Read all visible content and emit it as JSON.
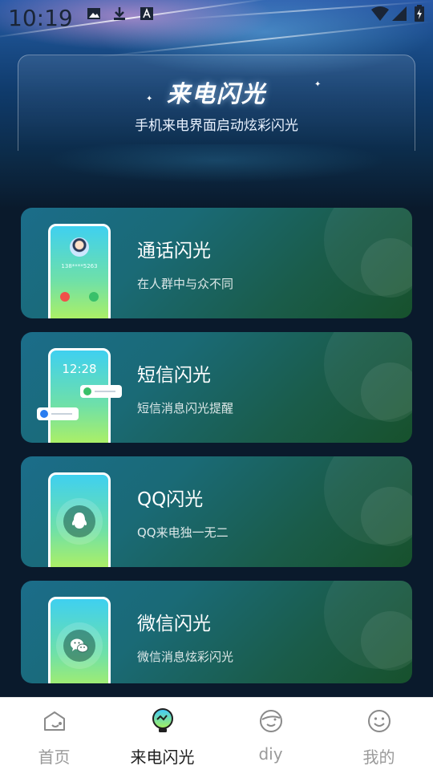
{
  "status_bar": {
    "time": "10:19",
    "icons": [
      "image-icon",
      "download-icon",
      "a-icon",
      "wifi-icon",
      "signal-icon",
      "battery-icon"
    ]
  },
  "header": {
    "title": "来电闪光",
    "subtitle": "手机来电界面启动炫彩闪光"
  },
  "cards": [
    {
      "title": "通话闪光",
      "desc": "在人群中与众不同",
      "phone_number": "138****5263"
    },
    {
      "title": "短信闪光",
      "desc": "短信消息闪光提醒",
      "phone_time": "12:28"
    },
    {
      "title": "QQ闪光",
      "desc": "QQ来电独一无二"
    },
    {
      "title": "微信闪光",
      "desc": "微信消息炫彩闪光"
    }
  ],
  "nav": {
    "items": [
      {
        "label": "首页",
        "icon": "home-icon",
        "active": false
      },
      {
        "label": "来电闪光",
        "icon": "lightbulb-icon",
        "active": true
      },
      {
        "label": "diy",
        "icon": "diy-face-icon",
        "active": false
      },
      {
        "label": "我的",
        "icon": "smiley-icon",
        "active": false
      }
    ]
  },
  "colors": {
    "active_nav": "#1f1f1f",
    "inactive_nav": "#9a9a9a",
    "card_start": "#1b6d8a",
    "card_end": "#17512c"
  }
}
